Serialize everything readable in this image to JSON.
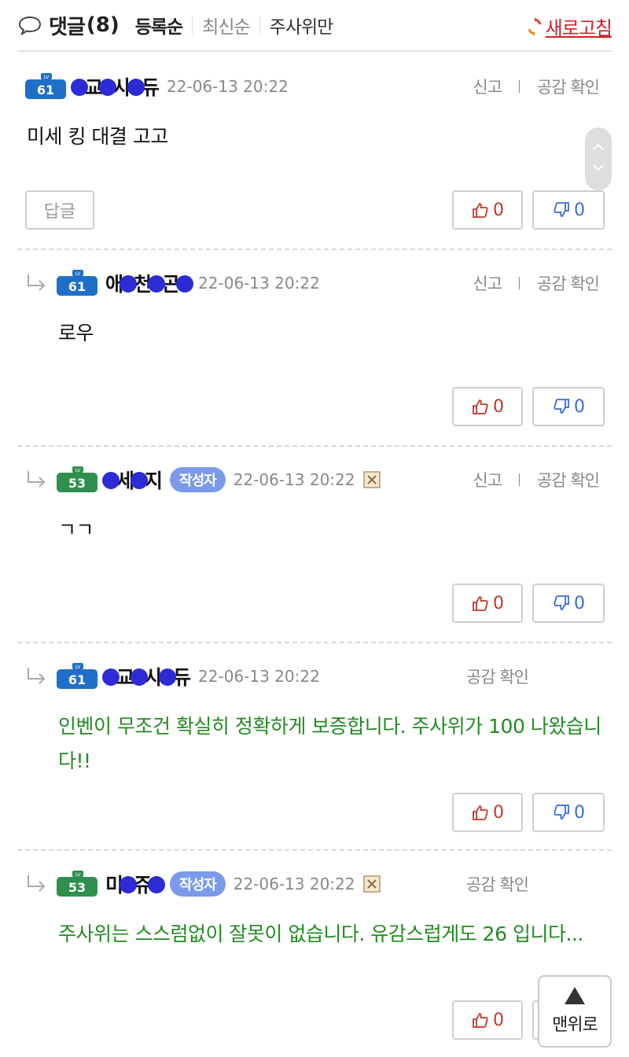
{
  "header": {
    "title": "댓글",
    "count": "(8)",
    "sort_options": [
      "등록순",
      "최신순",
      "주사위만"
    ],
    "refresh_label": "새로고침"
  },
  "actions": {
    "report": "신고",
    "like_check": "공감 확인",
    "reply_button": "답글"
  },
  "comments": [
    {
      "level": "61",
      "level_color": "#1f6fc8",
      "nick_parts": [
        "",
        "교",
        "사",
        "듀"
      ],
      "date": "22-06-13 20:22",
      "text": "미세 킹 대결 고고",
      "likes": "0",
      "dislikes": "0"
    },
    {
      "level": "61",
      "level_color": "#1f6fc8",
      "nick_parts": [
        "애",
        "천",
        "곤",
        ""
      ],
      "date": "22-06-13 20:22",
      "text": "로우",
      "likes": "0",
      "dislikes": "0"
    },
    {
      "level": "53",
      "level_color": "#2f8f4f",
      "nick_parts": [
        "",
        "세",
        "지"
      ],
      "badge": "작성자",
      "date": "22-06-13 20:22",
      "text": "ㄱㄱ",
      "likes": "0",
      "dislikes": "0"
    },
    {
      "level": "61",
      "level_color": "#1f6fc8",
      "nick_parts": [
        "",
        "교",
        "사",
        "듀"
      ],
      "date": "22-06-13 20:22",
      "text": "인벤이 무조건 확실히 정확하게 보증합니다. 주사위가 100 나왔습니다!!",
      "likes": "0",
      "dislikes": "0"
    },
    {
      "level": "53",
      "level_color": "#2f8f4f",
      "nick_parts": [
        "미",
        "쥬",
        ""
      ],
      "badge": "작성자",
      "date": "22-06-13 20:22",
      "text": "주사위는 스스럼없이 잘못이 없습니다. 유감스럽게도 26 입니다...",
      "likes": "0",
      "dislikes": ""
    }
  ],
  "top_button": "맨위로"
}
